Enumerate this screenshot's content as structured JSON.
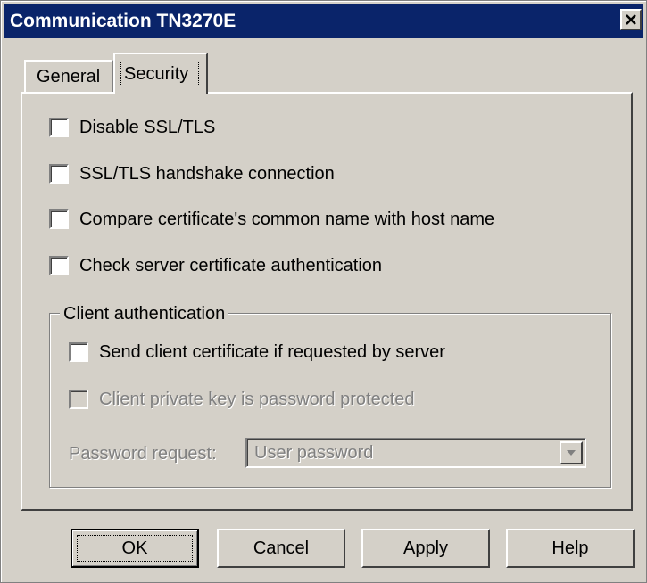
{
  "window": {
    "title": "Communication TN3270E"
  },
  "tabs": [
    {
      "label": "General",
      "selected": false
    },
    {
      "label": "Security",
      "selected": true
    }
  ],
  "security": {
    "options": [
      {
        "label": "Disable SSL/TLS",
        "checked": false,
        "enabled": true
      },
      {
        "label": "SSL/TLS handshake connection",
        "checked": false,
        "enabled": true
      },
      {
        "label": "Compare certificate's common name with host name",
        "checked": false,
        "enabled": true
      },
      {
        "label": "Check server certificate authentication",
        "checked": false,
        "enabled": true
      }
    ],
    "client_auth": {
      "group_label": "Client authentication",
      "send_cert": {
        "label": "Send client certificate if requested by server",
        "checked": false,
        "enabled": true
      },
      "key_protected": {
        "label": "Client private key is password protected",
        "checked": false,
        "enabled": false
      },
      "password_request": {
        "label": "Password request:",
        "value": "User password",
        "enabled": false
      }
    }
  },
  "buttons": {
    "ok": "OK",
    "cancel": "Cancel",
    "apply": "Apply",
    "help": "Help"
  },
  "icons": {
    "close": "close-icon",
    "dropdown": "chevron-down-icon"
  },
  "colors": {
    "titlebar": "#0a246a",
    "face": "#d4d0c8",
    "disabled_text": "#808080"
  }
}
